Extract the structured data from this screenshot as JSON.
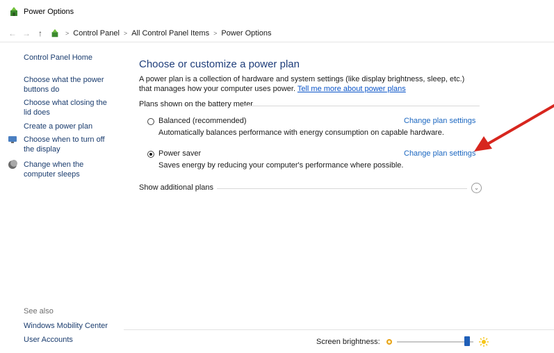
{
  "window": {
    "title": "Power Options",
    "icon": "power-options-icon"
  },
  "addressbar": {
    "crumbs": [
      "Control Panel",
      "All Control Panel Items",
      "Power Options"
    ]
  },
  "sidebar": {
    "home": "Control Panel Home",
    "links": [
      "Choose what the power buttons do",
      "Choose what closing the lid does",
      "Create a power plan",
      "Choose when to turn off the display",
      "Change when the computer sleeps"
    ],
    "see_also_label": "See also",
    "see_also": [
      "Windows Mobility Center",
      "User Accounts"
    ]
  },
  "main": {
    "heading": "Choose or customize a power plan",
    "intro": "A power plan is a collection of hardware and system settings (like display brightness, sleep, etc.) that manages how your computer uses power.",
    "intro_link": "Tell me more about power plans",
    "group_label": "Plans shown on the battery meter",
    "plans": [
      {
        "name": "Balanced (recommended)",
        "desc": "Automatically balances performance with energy consumption on capable hardware.",
        "link": "Change plan settings",
        "selected": false
      },
      {
        "name": "Power saver",
        "desc": "Saves energy by reducing your computer's performance where possible.",
        "link": "Change plan settings",
        "selected": true
      }
    ],
    "show_more": "Show additional plans"
  },
  "footer": {
    "brightness_label": "Screen brightness:",
    "brightness_value": 0.96
  },
  "colors": {
    "heading": "#1e3d7a",
    "link": "#1a66c0",
    "annotation_arrow": "#d7261e"
  }
}
